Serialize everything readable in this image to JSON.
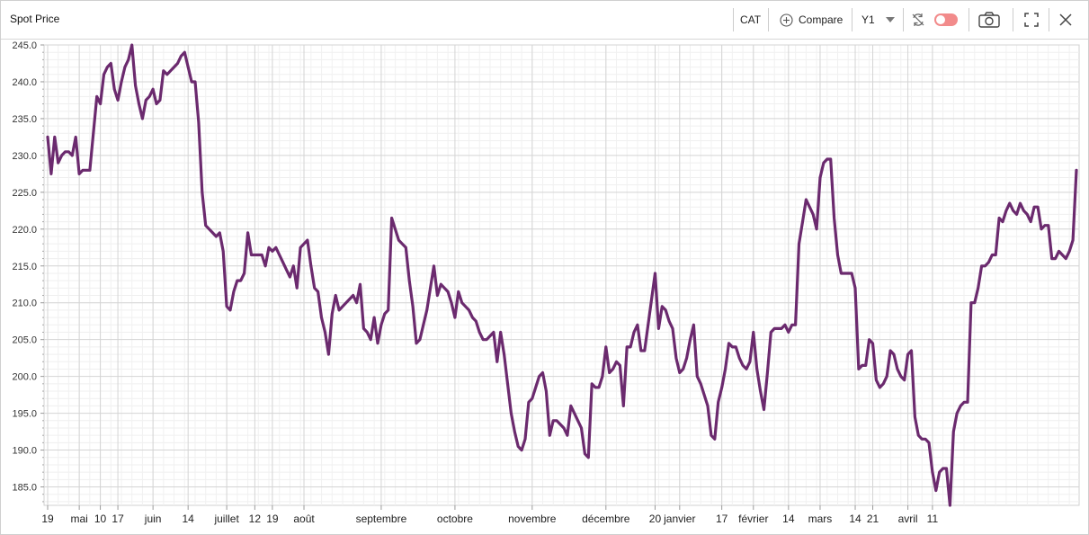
{
  "header": {
    "title": "Spot Price",
    "ticker": "CAT",
    "compare_label": "Compare",
    "period": "Y1"
  },
  "colors": {
    "line": "#6b2a6e",
    "grid_major": "#d6d6d6",
    "grid_minor": "#eeeeee",
    "toggle": "#f28b8b"
  },
  "icons": [
    "plus-circle-icon",
    "dropdown-arrow-icon",
    "refresh-icon",
    "toggle-switch",
    "camera-icon",
    "fullscreen-icon",
    "close-icon"
  ],
  "chart_data": {
    "type": "line",
    "title": "",
    "xlabel": "",
    "ylabel": "",
    "ylim": [
      182.5,
      245
    ],
    "y_ticks": [
      "185.0",
      "190.0",
      "195.0",
      "200.0",
      "205.0",
      "210.0",
      "215.0",
      "220.0",
      "225.0",
      "230.0",
      "235.0",
      "240.0",
      "245.0"
    ],
    "x_ticks": [
      {
        "label": "19",
        "i": 0
      },
      {
        "label": "mai",
        "i": 9
      },
      {
        "label": "10",
        "i": 15
      },
      {
        "label": "17",
        "i": 20
      },
      {
        "label": "juin",
        "i": 30
      },
      {
        "label": "14",
        "i": 40
      },
      {
        "label": "juillet",
        "i": 51
      },
      {
        "label": "12",
        "i": 59
      },
      {
        "label": "19",
        "i": 64
      },
      {
        "label": "août",
        "i": 73
      },
      {
        "label": "septembre",
        "i": 95
      },
      {
        "label": "octobre",
        "i": 116
      },
      {
        "label": "novembre",
        "i": 138
      },
      {
        "label": "décembre",
        "i": 159
      },
      {
        "label": "20",
        "i": 173
      },
      {
        "label": "janvier",
        "i": 180
      },
      {
        "label": "17",
        "i": 192
      },
      {
        "label": "février",
        "i": 201
      },
      {
        "label": "14",
        "i": 211
      },
      {
        "label": "mars",
        "i": 220
      },
      {
        "label": "14",
        "i": 230
      },
      {
        "label": "21",
        "i": 235
      },
      {
        "label": "avril",
        "i": 245
      },
      {
        "label": "11",
        "i": 252
      }
    ],
    "grid": true,
    "legend": "none",
    "series": [
      {
        "values": [
          232.5,
          227.5,
          232.5,
          229,
          230,
          230.5,
          230.5,
          230,
          232.5,
          227.5,
          228,
          228,
          228,
          233,
          238,
          237,
          241,
          242,
          242.5,
          239,
          237.5,
          240,
          242,
          243,
          245,
          239.5,
          237,
          235,
          237.5,
          238,
          239,
          237,
          237.5,
          241.5,
          241,
          241.5,
          242,
          242.5,
          243.5,
          244,
          242,
          240,
          240,
          234.5,
          225,
          220.5,
          220,
          219.5,
          219,
          219.5,
          217,
          209.5,
          209,
          211.5,
          213,
          213,
          214,
          219.5,
          216.5,
          216.5,
          216.5,
          216.5,
          215,
          217.5,
          217,
          217.5,
          216.5,
          215.5,
          214.5,
          213.5,
          215,
          212,
          217.5,
          218,
          218.5,
          215,
          212,
          211.5,
          208,
          206,
          203,
          208.5,
          211,
          209,
          209.5,
          210,
          210.5,
          211,
          210,
          212.5,
          206.5,
          206,
          205,
          208,
          204.5,
          207,
          208.5,
          209,
          221.5,
          220,
          218.5,
          218,
          217.5,
          213,
          209.5,
          204.5,
          205,
          207,
          209,
          212,
          215,
          211,
          212.5,
          212,
          211.5,
          210,
          208,
          211.5,
          210,
          209.5,
          209,
          208,
          207.5,
          206,
          205,
          205,
          205.5,
          206,
          202,
          206,
          203,
          199,
          195,
          192.5,
          190.5,
          190,
          191.5,
          196.5,
          197,
          198.5,
          200,
          200.5,
          198,
          192,
          194,
          194,
          193.5,
          193,
          192,
          196,
          195,
          194,
          193,
          189.5,
          189,
          199,
          198.5,
          198.5,
          200,
          204,
          200.5,
          201,
          202,
          201.5,
          196,
          204,
          204,
          206,
          207,
          203.5,
          203.5,
          207,
          210.5,
          214,
          206.5,
          209.5,
          209,
          207.5,
          206.5,
          202.5,
          200.5,
          201,
          202.5,
          205,
          207,
          200,
          199,
          197.5,
          196,
          192,
          191.5,
          196.5,
          198.5,
          201,
          204.5,
          204,
          204,
          202.5,
          201.5,
          201,
          202,
          206,
          201,
          198,
          195.5,
          200.5,
          206,
          206.5,
          206.5,
          206.5,
          207,
          206,
          207,
          207,
          218,
          221,
          224,
          223,
          222,
          220,
          227,
          229,
          229.5,
          229.5,
          221.5,
          216.5,
          214,
          214,
          214,
          214,
          212,
          201,
          201.5,
          201.5,
          205,
          204.5,
          199.5,
          198.5,
          199,
          200,
          203.5,
          203,
          201,
          200,
          199.5,
          203,
          203.5,
          194.5,
          192,
          191.5,
          191.5,
          191,
          187,
          184.5,
          187,
          187.5,
          187.5,
          182.5,
          192.5,
          195,
          196,
          196.5,
          196.5,
          210,
          210,
          212,
          215,
          215,
          215.5,
          216.5,
          216.5,
          221.5,
          221,
          222.5,
          223.5,
          222.5,
          222,
          223.5,
          222.5,
          222,
          221,
          223,
          223,
          220,
          220.5,
          220.5,
          216,
          216,
          217,
          216.5,
          216,
          217,
          218.5,
          228
        ]
      }
    ]
  }
}
